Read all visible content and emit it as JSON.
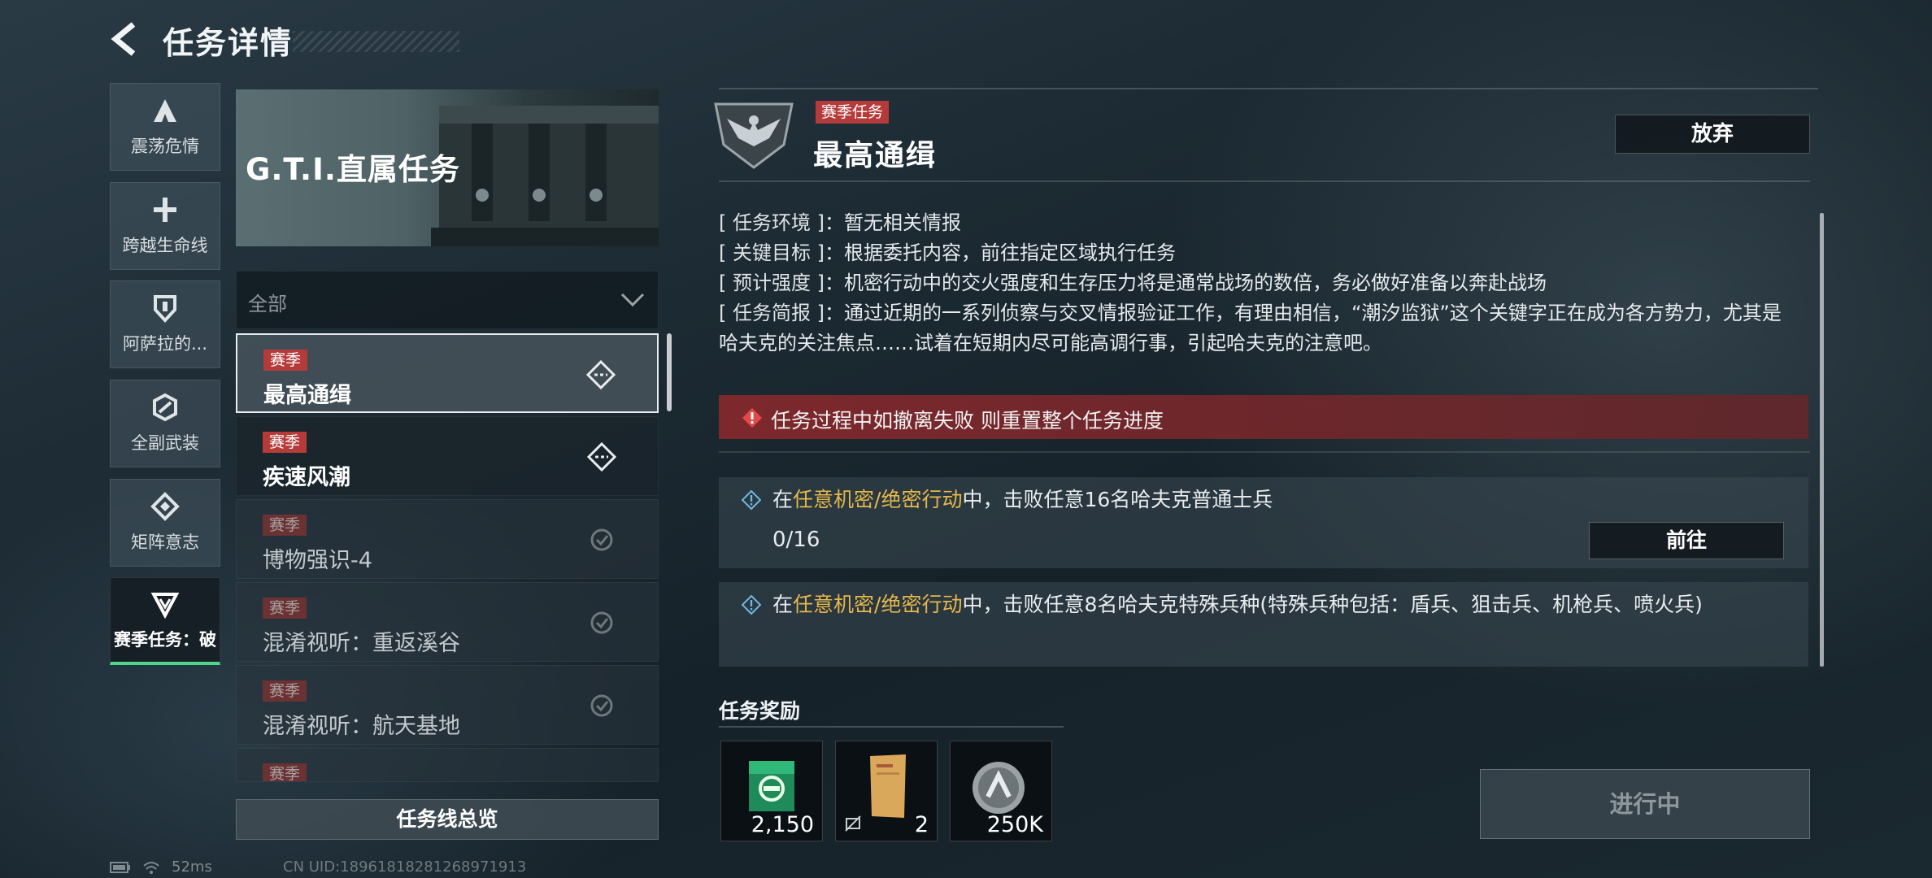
{
  "header": {
    "title": "任务详情"
  },
  "nav": [
    {
      "label": "震荡危情",
      "icon": "triangle-icon"
    },
    {
      "label": "跨越生命线",
      "icon": "cross-icon"
    },
    {
      "label": "阿萨拉的...",
      "icon": "shield-icon"
    },
    {
      "label": "全副武装",
      "icon": "hex-icon"
    },
    {
      "label": "矩阵意志",
      "icon": "diamond-icon"
    },
    {
      "label": "赛季任务：破",
      "icon": "chevron-triangle-icon",
      "active": true
    }
  ],
  "banner": {
    "title": "G.T.I.直属任务"
  },
  "filter": {
    "selected": "全部"
  },
  "tasks": [
    {
      "tag": "赛季",
      "name": "最高通缉",
      "state": "selected"
    },
    {
      "tag": "赛季",
      "name": "疾速风潮",
      "state": "normal"
    },
    {
      "tag": "赛季",
      "name": "博物强识-4",
      "state": "done"
    },
    {
      "tag": "赛季",
      "name": "混淆视听：重返溪谷",
      "state": "done"
    },
    {
      "tag": "赛季",
      "name": "混淆视听：航天基地",
      "state": "done"
    },
    {
      "tag": "赛季",
      "name": "",
      "state": "done"
    }
  ],
  "overview_button": "任务线总览",
  "status": {
    "ping": "52ms",
    "uid": "CN UID:18961818281268971913"
  },
  "mission": {
    "tag": "赛季任务",
    "title": "最高通缉",
    "abandon": "放弃",
    "info": [
      {
        "key": "[ 任务环境 ]：",
        "value": "暂无相关情报"
      },
      {
        "key": "[ 关键目标 ]：",
        "value": "根据委托内容，前往指定区域执行任务"
      },
      {
        "key": "[ 预计强度 ]：",
        "value": "机密行动中的交火强度和生存压力将是通常战场的数倍，务必做好准备以奔赴战场"
      },
      {
        "key": "[ 任务简报 ]：",
        "value": "通过近期的一系列侦察与交叉情报验证工作，有理由相信，“潮汐监狱”这个关键字正在成为各方势力，尤其是哈夫克的关注焦点……试着在短期内尽可能高调行事，引起哈夫克的注意吧。"
      }
    ],
    "warning": "任务过程中如撤离失败 则重置整个任务进度",
    "objectives": [
      {
        "prefix": "在",
        "highlight": "任意机密/绝密行动",
        "suffix": "中，击败任意16名哈夫克普通士兵",
        "progress": "0/16",
        "button": "前往"
      },
      {
        "prefix": "在",
        "highlight": "任意机密/绝密行动",
        "suffix": "中，击败任意8名哈夫克特殊兵种(特殊兵种包括：盾兵、狙击兵、机枪兵、喷火兵)"
      }
    ],
    "reward_title": "任务奖励",
    "rewards": [
      {
        "qty": "2,150",
        "icon": "experience-icon"
      },
      {
        "qty": "2",
        "icon": "document-icon"
      },
      {
        "qty": "250K",
        "icon": "coin-icon"
      }
    ],
    "status_button": "进行中"
  },
  "colors": {
    "accent_green": "#4fd68a",
    "tag_red": "#b53b3b",
    "highlight_gold": "#e6b84a",
    "warning_bg": "#82282c"
  }
}
